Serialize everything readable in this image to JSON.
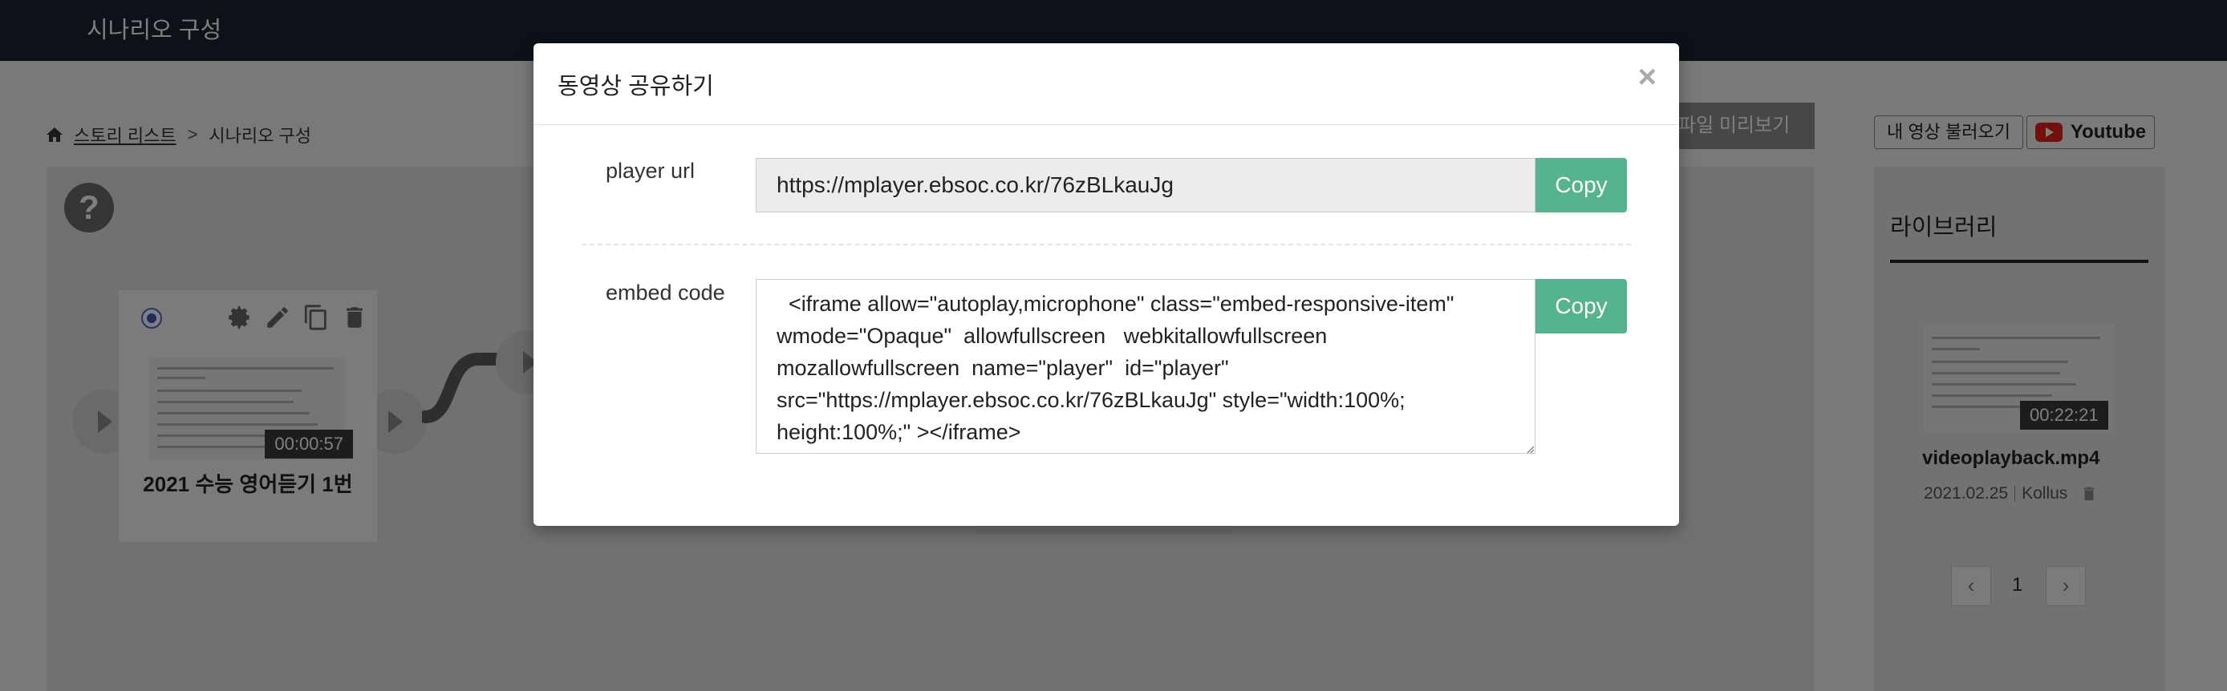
{
  "app": {
    "title": "시나리오 구성"
  },
  "breadcrumb": {
    "story_list": "스토리 리스트",
    "separator": ">",
    "current": "시나리오 구성"
  },
  "toolbar": {
    "preview_label": "파일 미리보기"
  },
  "canvas": {
    "help_label": "?",
    "card": {
      "title": "2021 수능 영어듣기 1번",
      "duration": "00:00:57"
    }
  },
  "library": {
    "my_video_button": "내 영상 불러오기",
    "youtube_button": "Youtube",
    "title": "라이브러리",
    "item": {
      "name": "videoplayback.mp4",
      "date": "2021.02.25",
      "source": "Kollus",
      "duration": "00:22:21"
    },
    "pagination": {
      "prev": "‹",
      "page": "1",
      "next": "›"
    }
  },
  "modal": {
    "title": "동영상 공유하기",
    "close": "×",
    "player_url_label": "player url",
    "player_url_value": "https://mplayer.ebsoc.co.kr/76zBLkauJg",
    "embed_label": "embed code",
    "embed_value": "  <iframe allow=\"autoplay,microphone\" class=\"embed-responsive-item\" wmode=\"Opaque\"  allowfullscreen   webkitallowfullscreen mozallowfullscreen  name=\"player\"  id=\"player\" src=\"https://mplayer.ebsoc.co.kr/76zBLkauJg\" style=\"width:100%; height:100%;\" ></iframe>",
    "copy_label": "Copy"
  },
  "colors": {
    "topbar": "#1b2433",
    "copy_button": "#55b38f",
    "youtube_red": "#e62117"
  }
}
